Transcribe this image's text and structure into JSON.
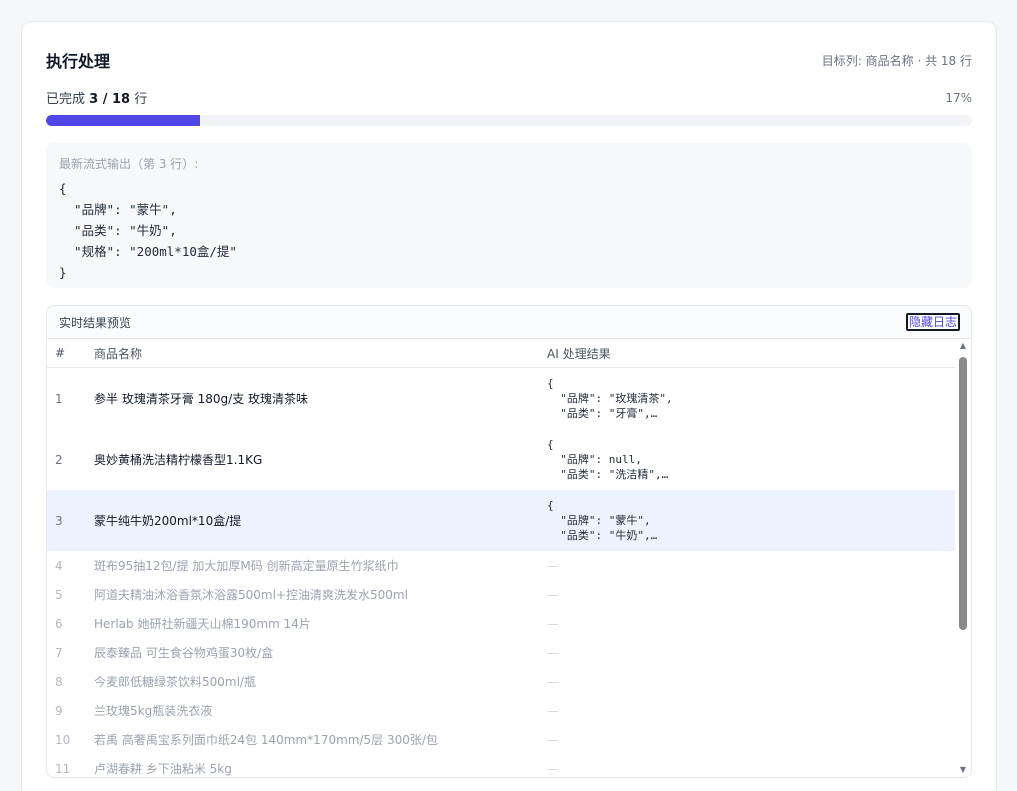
{
  "header": {
    "title": "执行处理",
    "target_info": "目标列: 商品名称 · 共 18 行"
  },
  "progress": {
    "label_prefix": "已完成",
    "count": "3 / 18",
    "label_suffix": "行",
    "percent_text": "17%",
    "fraction": 0.1667,
    "bar_color": "#4f46e5"
  },
  "stream": {
    "title": "最新流式输出（第 3 行）:",
    "output": "{\n  \"品牌\": \"蒙牛\",\n  \"品类\": \"牛奶\",\n  \"规格\": \"200ml*10盒/提\"\n}"
  },
  "preview": {
    "title": "实时结果预览",
    "hide_log_label": "隐藏日志",
    "columns": [
      "#",
      "商品名称",
      "AI 处理结果"
    ],
    "rows": [
      {
        "num": "1",
        "name": "参半 玫瑰清茶牙膏 180g/支 玫瑰清茶味",
        "result": "{\n  \"品牌\": \"玫瑰清茶\",\n  \"品类\": \"牙膏\",…"
      },
      {
        "num": "2",
        "name": "奥妙黄桶洗洁精柠檬香型1.1KG",
        "result": "{\n  \"品牌\": null,\n  \"品类\": \"洗洁精\",…"
      },
      {
        "num": "3",
        "name": "蒙牛纯牛奶200ml*10盒/提",
        "result": "{\n  \"品牌\": \"蒙牛\",\n  \"品类\": \"牛奶\",…"
      },
      {
        "num": "4",
        "name": "斑布95抽12包/提 加大加厚M码 创新高定量原生竹浆纸巾",
        "result": "—"
      },
      {
        "num": "5",
        "name": "阿道夫精油沐浴香氛沐浴露500ml+控油清爽洗发水500ml",
        "result": "—"
      },
      {
        "num": "6",
        "name": "Herlab 她研社新疆天山棉190mm 14片",
        "result": "—"
      },
      {
        "num": "7",
        "name": "辰泰臻品 可生食谷物鸡蛋30枚/盒",
        "result": "—"
      },
      {
        "num": "8",
        "name": "今麦郎低糖绿茶饮料500ml/瓶",
        "result": "—"
      },
      {
        "num": "9",
        "name": "兰玫瑰5kg瓶装洗衣液",
        "result": "—"
      },
      {
        "num": "10",
        "name": "若禹 高奢禹宝系列面巾纸24包 140mm*170mm/5层 300张/包",
        "result": "—"
      },
      {
        "num": "11",
        "name": "卢湖春耕 乡下油粘米 5kg",
        "result": "—"
      }
    ]
  }
}
